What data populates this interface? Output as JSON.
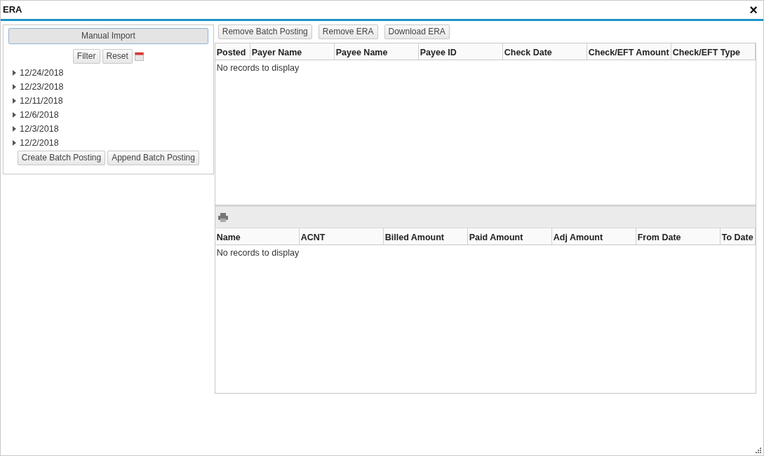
{
  "window": {
    "title": "ERA",
    "close": "×"
  },
  "left_panel": {
    "import_button": "Manual Import",
    "filter_button": "Filter",
    "reset_button": "Reset",
    "dates": [
      {
        "label": "12/24/2018",
        "expanded": false
      },
      {
        "label": "12/23/2018",
        "expanded": false
      },
      {
        "label": "12/11/2018",
        "expanded": false
      },
      {
        "label": "12/6/2018",
        "expanded": false
      },
      {
        "label": "12/3/2018",
        "expanded": false
      },
      {
        "label": "12/2/2018",
        "expanded": false
      }
    ],
    "buttons": [
      "Create Batch Posting",
      "Append Batch Posting"
    ]
  },
  "toolbar": [
    "Remove Batch Posting",
    "Remove ERA",
    "Download ERA"
  ],
  "era_table": {
    "columns": [
      "Posted",
      "Payer Name",
      "Payee Name",
      "Payee ID",
      "Check Date",
      "Check/EFT Amount",
      "Check/EFT Type"
    ],
    "empty_message": "No records to display"
  },
  "detail_table": {
    "columns": [
      "Name",
      "ACNT",
      "Billed Amount",
      "Paid Amount",
      "Adj Amount",
      "From Date",
      "To Date"
    ],
    "empty_message": "No records to display"
  }
}
